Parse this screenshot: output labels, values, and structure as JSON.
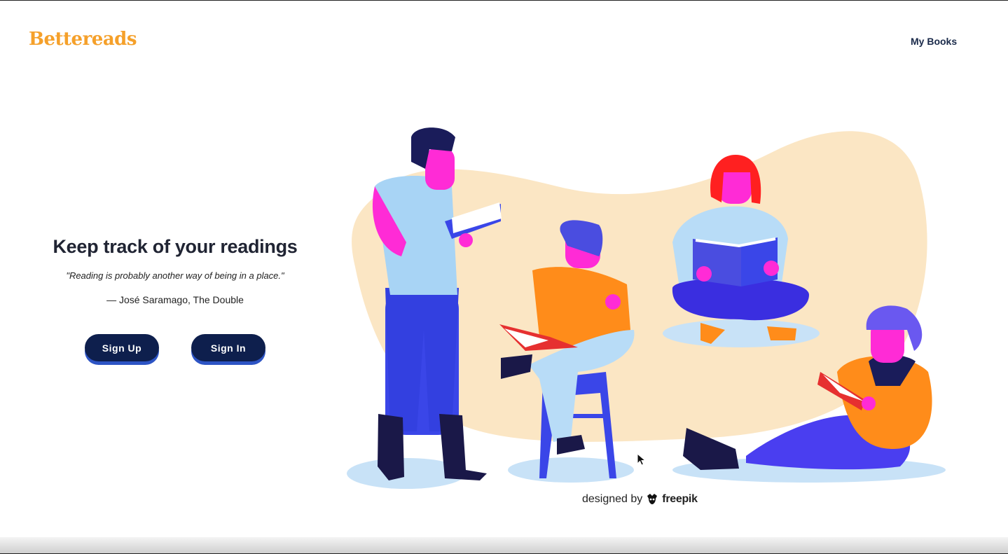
{
  "header": {
    "brand": "Bettereads",
    "nav_my_books": "My Books"
  },
  "hero": {
    "title": "Keep track of your readings",
    "quote": "\"Reading is probably another way of being in a place.\"",
    "author": "— José Saramago, The Double",
    "signup_label": "Sign Up",
    "signin_label": "Sign In"
  },
  "illustration": {
    "credit_prefix": "designed by",
    "credit_brand": "freepik"
  },
  "colors": {
    "brand": "#f5a02a",
    "button_bg": "#0e1f4d",
    "button_shadow": "#2d54c4",
    "blob": "#fbe6c4",
    "skin": "#ff2bd6"
  }
}
